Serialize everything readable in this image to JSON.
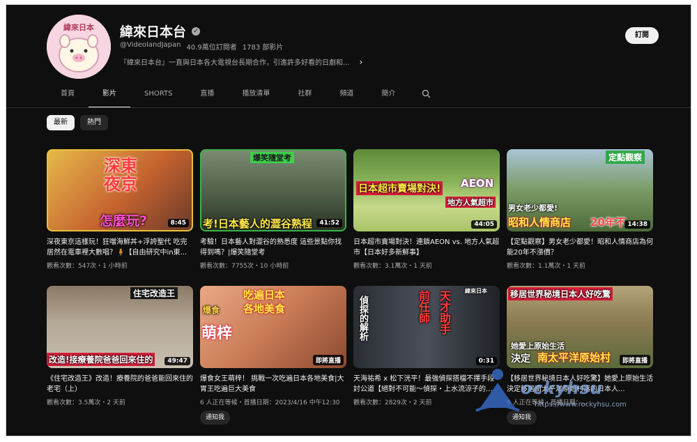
{
  "channel": {
    "name": "緯來日本台",
    "avatar_text": "緯來日本",
    "handle": "@VideolandJapan",
    "subscribers": "40.9萬位訂閱者",
    "video_count": "1783 部影片",
    "description": "『緯來日本台』一直與日本各大電視台長期合作，引進許多好看的日劇和...",
    "subscribe_label": "訂閱"
  },
  "tabs": [
    {
      "label": "首頁"
    },
    {
      "label": "影片"
    },
    {
      "label": "SHORTS"
    },
    {
      "label": "直播"
    },
    {
      "label": "播放清單"
    },
    {
      "label": "社群"
    },
    {
      "label": "頻道"
    },
    {
      "label": "簡介"
    }
  ],
  "active_tab": "影片",
  "chips": [
    {
      "label": "最新"
    },
    {
      "label": "熱門"
    }
  ],
  "videos": [
    {
      "title": "深夜東京這樣玩！狂噹海鮮丼+浮誇聖代 吃完居然在電車裡大數唱？🧍【自由研究中in東...",
      "meta": "觀看次數：547次・1 小時前",
      "duration": "8:45",
      "thumb_lines": [
        "深東",
        "夜京",
        "怎麼玩?"
      ],
      "thumb_colors": [
        "#d9a43b",
        "#8a3b22"
      ]
    },
    {
      "title": "考驗！日本藝人對澀谷的熟悉度 這些景點你找得到嗎？|爆笑隨堂考",
      "meta": "觀看次數：7755次・10 小時前",
      "duration": "41:52",
      "thumb_lines": [
        "爆笑隨堂考",
        "考!日本藝人的澀谷熟程"
      ],
      "thumb_colors": [
        "#5a6a52",
        "#2d3b2a"
      ]
    },
    {
      "title": "日本超市賣場對決！連鎖AEON vs. 地方人氣超市【日本好多新鮮事】",
      "meta": "觀看次數：3.1萬次・1 天前",
      "duration": "44:05",
      "thumb_lines": [
        "日本超市賣場對決!",
        "AEON",
        "地方人氣超市"
      ],
      "thumb_colors": [
        "#6f9a45",
        "#c9d98a"
      ]
    },
    {
      "title": "【定點觀察】男女老少都愛！昭和人情商店為何能20年不漲價？",
      "meta": "觀看次數：1.1萬次・1 天前",
      "duration": "14:38",
      "thumb_lines": [
        "定點觀察",
        "男女老少都愛!",
        "昭和人情商店",
        "20年不"
      ],
      "thumb_colors": [
        "#8fb0c9",
        "#5f7a4a"
      ]
    },
    {
      "title": "《住宅改造王》改造！療養院的爸爸能回來住的老宅（上）",
      "meta": "觀看次數：3.5萬次・2 天前",
      "duration": "49:47",
      "thumb_lines": [
        "住宅改造王",
        "改造!接療養院爸爸回來住的"
      ],
      "thumb_colors": [
        "#a89a86",
        "#6b5b48"
      ]
    },
    {
      "title": "爆食女王萌梓！ 挑戰一次吃遍日本各地美食|大胃王吃遍巨大美食",
      "meta": "6 人正在等候・首播日期：2023/4/16 中午12:30",
      "badge": "即將直播",
      "notify": "通知我",
      "thumb_lines": [
        "吃遍日本",
        "各地美食",
        "爆食",
        "萌梓"
      ],
      "thumb_colors": [
        "#d98f6a",
        "#a05a3a"
      ]
    },
    {
      "title": "天海祐希 x 松下洸平！最強偵探搭檔不擇手段討公道【絕對不可能～偵探・上水流涼子的...",
      "meta": "觀看次數：2829次・2 天前",
      "duration": "0:31",
      "thumb_lines": [
        "偵探的解析",
        "前任師",
        "天才助手",
        "緯來日本"
      ],
      "thumb_colors": [
        "#3a3f4a",
        "#1a1d22"
      ]
    },
    {
      "title": "【移居世界秘境日本人好吃驚】她愛上原始生活 決定移居南太平洋原始村落的日本人...",
      "meta": "6 人正在等候・首播日期：...",
      "badge": "即將直播",
      "notify": "通知我",
      "thumb_lines": [
        "移居世界秘境日本人好吃驚",
        "她愛上原始生活",
        "決定",
        "南太平洋原始村"
      ],
      "thumb_colors": [
        "#9a8a62",
        "#5e6b3a"
      ]
    }
  ],
  "watermark": {
    "brand": "ockyhsu",
    "url": "https://www.rockyhsu.com"
  }
}
